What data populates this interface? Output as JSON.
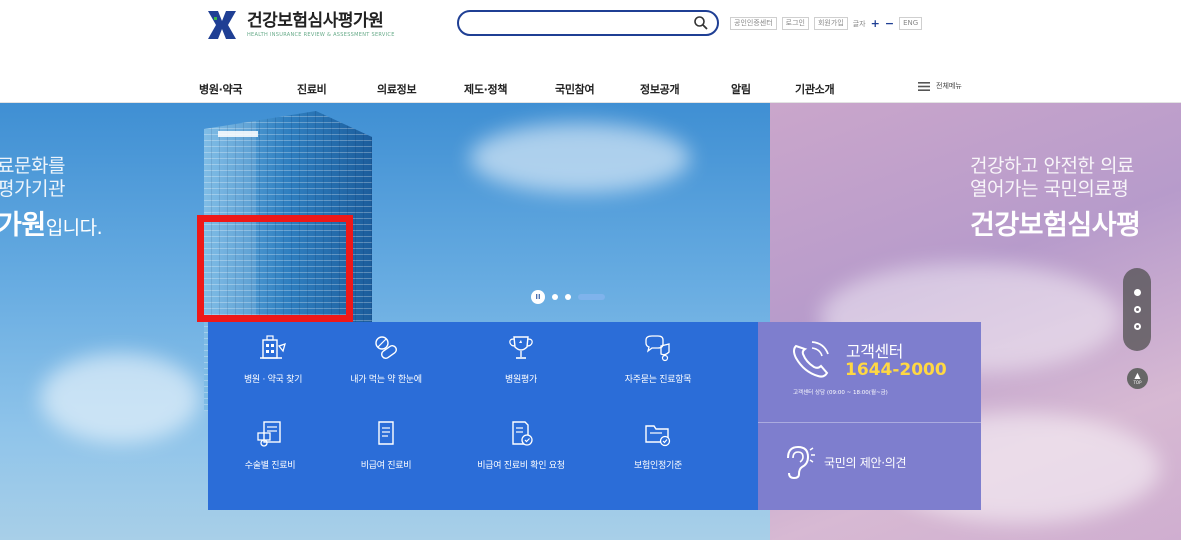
{
  "header": {
    "logo": {
      "name": "건강보험심사평가원",
      "subtitle": "HEALTH INSURANCE REVIEW & ASSESSMENT SERVICE"
    },
    "search": {
      "value": "",
      "placeholder": ""
    },
    "util": {
      "cert_center": "공인인증센터",
      "login": "로그인",
      "join": "회원가입",
      "font_size_label": "글자",
      "zoom_in": "+",
      "zoom_out": "−",
      "lang": "ENG"
    },
    "gnb": [
      "병원·약국",
      "진료비",
      "의료정보",
      "제도·정책",
      "국민참여",
      "정보공개",
      "알림",
      "기관소개"
    ],
    "all_menu": "전체메뉴"
  },
  "banner": {
    "left_slide": {
      "line1": "료문화를",
      "line2": "평가기관",
      "big": "가원",
      "big_suffix": "입니다."
    },
    "right_slide": {
      "line1": "건강하고 안전한 의료",
      "line2": "열어가는 국민의료평",
      "big": "건강보험심사평"
    },
    "top_label": "TOP"
  },
  "quick_menu": [
    {
      "label": "병원 · 약국 찾기",
      "icon": "hospital-search-icon"
    },
    {
      "label": "내가 먹는 약 한눈에",
      "icon": "pill-icon"
    },
    {
      "label": "병원평가",
      "icon": "trophy-icon"
    },
    {
      "label": "자주묻는 진료항목",
      "icon": "faq-medical-icon"
    },
    {
      "label": "수술별 진료비",
      "icon": "surgery-bill-icon"
    },
    {
      "label": "비급여 진료비",
      "icon": "document-icon"
    },
    {
      "label": "비급여 진료비 확인 요청",
      "icon": "document-check-icon"
    },
    {
      "label": "보험인정기준",
      "icon": "folder-check-icon"
    }
  ],
  "customer_center": {
    "title": "고객센터",
    "phone": "1644-2000",
    "hours": "고객센터 상담 (09:00 ~ 18:00(월~금)",
    "opinion": "국민의 제안·의견"
  },
  "colors": {
    "brand": "#1f3f94",
    "panel_blue": "#2b6dd8",
    "panel_purple": "#7e7ece",
    "phone_yellow": "#ffd843",
    "highlight_red": "#ef1818"
  }
}
